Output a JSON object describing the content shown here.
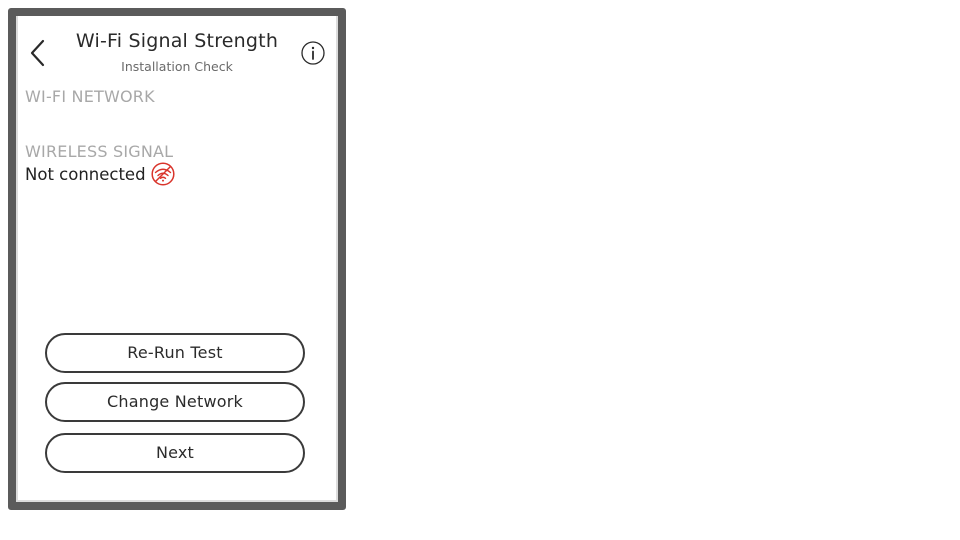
{
  "header": {
    "title": "Wi-Fi Signal Strength",
    "subtitle": "Installation Check",
    "back_icon": "chevron-left-icon",
    "info_icon": "info-icon"
  },
  "sections": {
    "wifi_network_label": "WI-FI NETWORK",
    "wireless_signal_label": "WIRELESS SIGNAL",
    "signal_status": "Not connected",
    "signal_status_icon": "no-wifi-icon"
  },
  "buttons": {
    "rerun_label": "Re-Run Test",
    "change_network_label": "Change Network",
    "next_label": "Next"
  },
  "colors": {
    "frame": "#5b5b5b",
    "error": "#d9342b",
    "button_border": "#3a3a3a",
    "label_gray": "#a8a8a8"
  }
}
